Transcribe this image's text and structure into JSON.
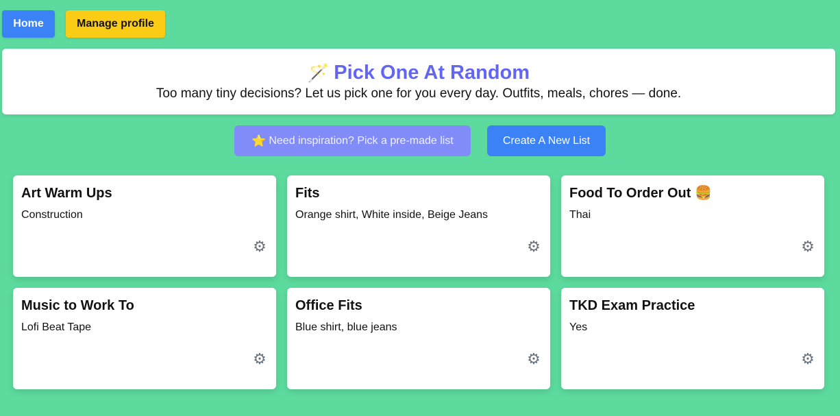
{
  "nav": {
    "home_label": "Home",
    "profile_label": "Manage profile"
  },
  "hero": {
    "icon": "magic-wand-icon",
    "title": "Pick One At Random",
    "subtitle": "Too many tiny decisions? Let us pick one for you every day. Outfits, meals, chores — done."
  },
  "actions": {
    "inspire_icon": "star-icon",
    "inspire_label": "Need inspiration? Pick a pre-made list",
    "create_label": "Create A New List"
  },
  "lists": [
    {
      "title": "Art Warm Ups",
      "value": "Construction"
    },
    {
      "title": "Fits",
      "value": "Orange shirt, White inside, Beige Jeans"
    },
    {
      "title": "Food To Order Out 🍔",
      "value": "Thai"
    },
    {
      "title": "Music to Work To",
      "value": "Lofi Beat Tape"
    },
    {
      "title": "Office Fits",
      "value": "Blue shirt, blue jeans"
    },
    {
      "title": "TKD Exam Practice",
      "value": "Yes"
    }
  ],
  "colors": {
    "background": "#5ddb9e",
    "accent_title": "#6366f1",
    "home_button": "#3b82f6",
    "profile_button": "#facc15",
    "inspire_button": "#818cf8",
    "create_button": "#3b82f6"
  },
  "card_icon": "gear-icon"
}
